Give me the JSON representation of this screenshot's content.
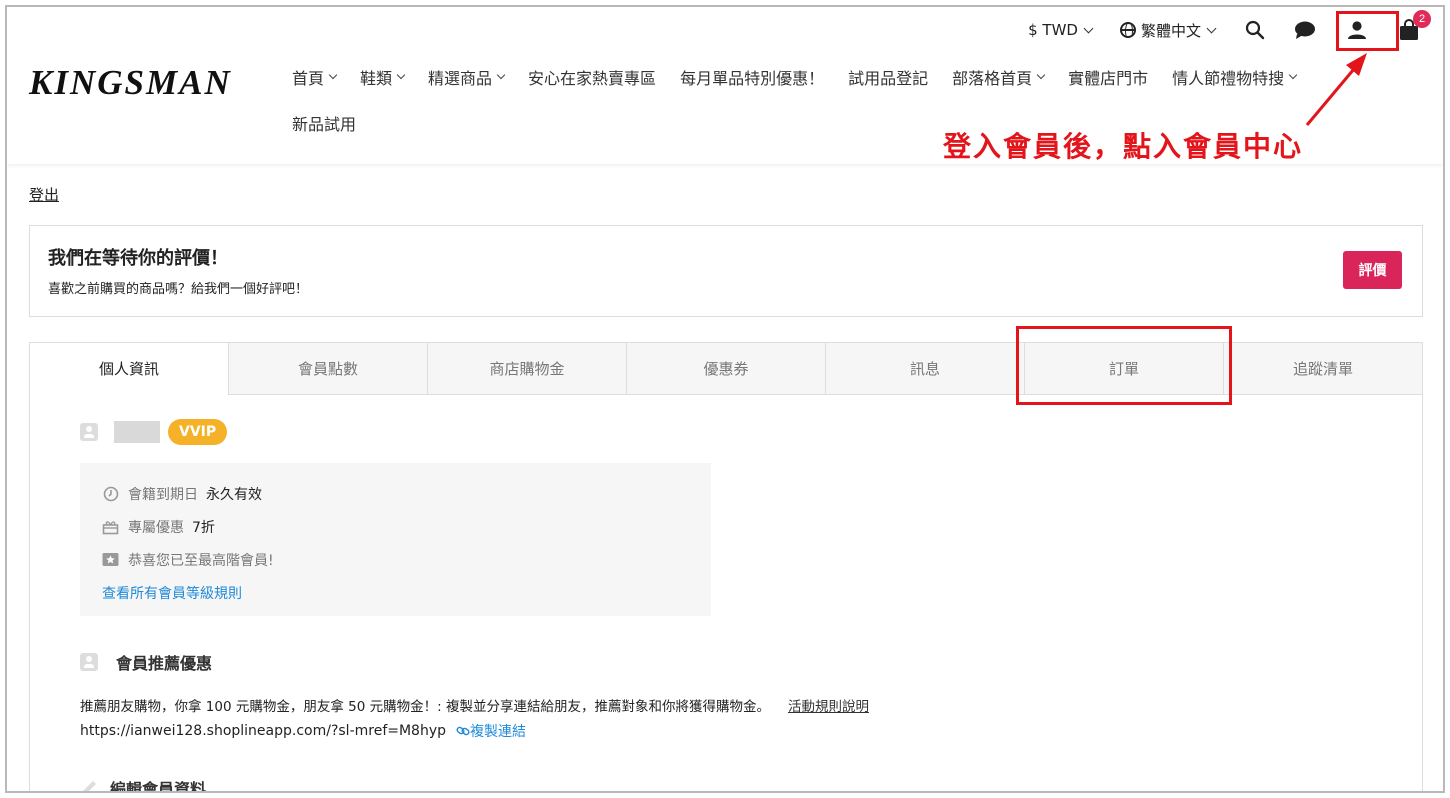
{
  "topbar": {
    "currency": "$ TWD",
    "language": "繁體中文",
    "cart_count": "2"
  },
  "brand": {
    "logo": "KINGSMAN"
  },
  "nav": {
    "items": [
      {
        "label": "首頁",
        "dropdown": true
      },
      {
        "label": "鞋類",
        "dropdown": true
      },
      {
        "label": "精選商品",
        "dropdown": true
      },
      {
        "label": "安心在家熱賣專區",
        "dropdown": false
      },
      {
        "label": "每月單品特別優惠！",
        "dropdown": false
      },
      {
        "label": "試用品登記",
        "dropdown": false
      },
      {
        "label": "部落格首頁",
        "dropdown": true
      },
      {
        "label": "實體店門市",
        "dropdown": false
      },
      {
        "label": "情人節禮物特搜",
        "dropdown": true
      }
    ],
    "row2": "新品試用"
  },
  "annotation": {
    "text": "登入會員後，點入會員中心",
    "color": "#e4141b"
  },
  "account": {
    "logout": "登出"
  },
  "review": {
    "title": "我們在等待你的評價！",
    "subtitle": "喜歡之前購買的商品嗎？給我們一個好評吧！",
    "button": "評價"
  },
  "tabs": [
    "個人資訊",
    "會員點數",
    "商店購物金",
    "優惠券",
    "訊息",
    "訂單",
    "追蹤清單"
  ],
  "profile": {
    "tier_badge": "VVIP",
    "expiry_label": "會籍到期日",
    "expiry_value": "永久有效",
    "discount_label": "專屬優惠",
    "discount_value": "7折",
    "top_tier_msg": "恭喜您已至最高階會員!",
    "rules_link": "查看所有會員等級規則"
  },
  "referral": {
    "title": "會員推薦優惠",
    "desc": "推薦朋友購物，你拿 100 元購物金，朋友拿 50 元購物金！: 複製並分享連結給朋友，推薦對象和你將獲得購物金。",
    "rules_link": "活動規則說明",
    "url": "https://ianwei128.shoplineapp.com/?sl-mref=M8hyp",
    "copy_link": "複製連結"
  },
  "edit": {
    "title": "編輯會員資料"
  },
  "colors": {
    "accent": "#d92559",
    "vvip": "#f5b229",
    "link": "#1f8ad8"
  }
}
